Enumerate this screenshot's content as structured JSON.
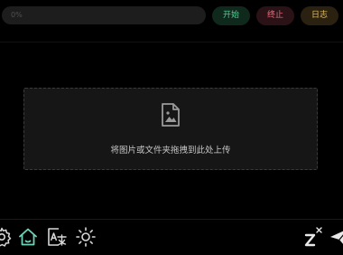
{
  "toolbar": {
    "progress_text": "0%",
    "progress_value": 0,
    "start_label": "开始",
    "stop_label": "终止",
    "log_label": "日志"
  },
  "dropzone": {
    "icon": "image-file-icon",
    "text": "将图片或文件夹拖拽到此处上传"
  },
  "bottom_bar": {
    "icons": [
      "gear-icon",
      "home-icon",
      "translate-icon",
      "sun-icon",
      "sleep-icon",
      "send-icon"
    ]
  },
  "colors": {
    "background": "#000000",
    "start": "#4cd195",
    "stop": "#e0707e",
    "log": "#e7bf5e",
    "icon_accent": "#6ed3b6"
  }
}
